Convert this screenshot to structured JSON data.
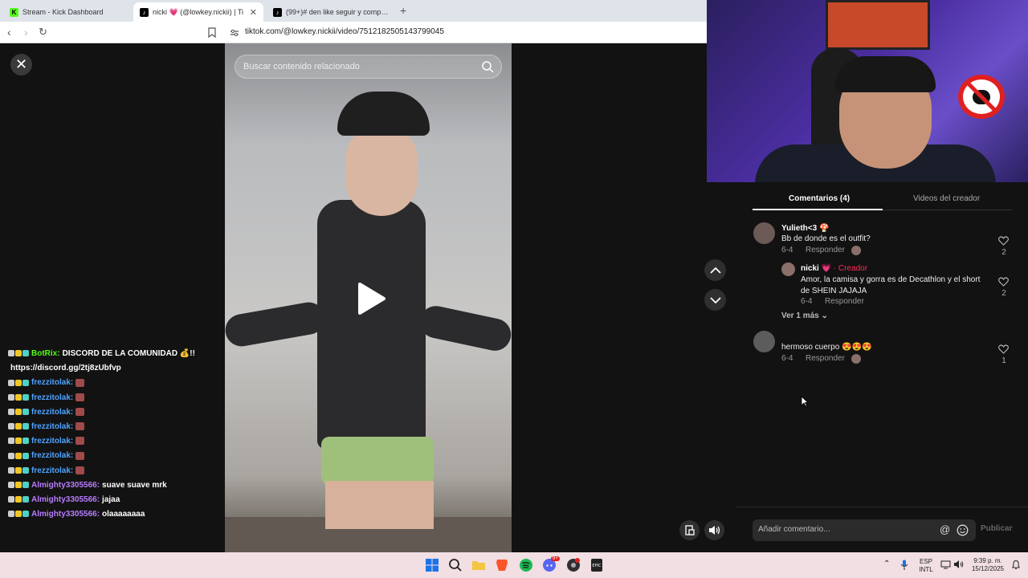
{
  "browser": {
    "tabs": [
      {
        "label": "Stream - Kick Dashboard",
        "favicon_color": "#53fc18",
        "favicon_letter": "K"
      },
      {
        "label": "nicki 💗 (@lowkey.nickii) | Ti",
        "favicon_color": "#000000",
        "favicon_letter": "♪"
      },
      {
        "label": "(99+)# den like seguir y compartir nc",
        "favicon_color": "#000000",
        "favicon_letter": "♪"
      }
    ],
    "url": "tiktok.com/@lowkey.nickii/video/7512182505143799045"
  },
  "video": {
    "search_placeholder": "Buscar contenido relacionado"
  },
  "chat": [
    {
      "user": "BotRix:",
      "message": "DISCORD DE LA COMUNIDAD 💰!!",
      "user_color": "#53fc18"
    },
    {
      "user": "",
      "message": "https://discord.gg/2tj8zUbfvp",
      "user_color": "#ffffff"
    },
    {
      "user": "frezzitolak:",
      "message": "",
      "user_color": "#4fa3ff"
    },
    {
      "user": "frezzitolak:",
      "message": "",
      "user_color": "#4fa3ff"
    },
    {
      "user": "frezzitolak:",
      "message": "",
      "user_color": "#4fa3ff"
    },
    {
      "user": "frezzitolak:",
      "message": "",
      "user_color": "#4fa3ff"
    },
    {
      "user": "frezzitolak:",
      "message": "",
      "user_color": "#4fa3ff"
    },
    {
      "user": "frezzitolak:",
      "message": "",
      "user_color": "#4fa3ff"
    },
    {
      "user": "frezzitolak:",
      "message": "",
      "user_color": "#4fa3ff"
    },
    {
      "user": "Almighty3305566:",
      "message": "suave suave mrk",
      "user_color": "#b77cff"
    },
    {
      "user": "Almighty3305566:",
      "message": "jajaa",
      "user_color": "#b77cff"
    },
    {
      "user": "Almighty3305566:",
      "message": "olaaaaaaaa",
      "user_color": "#b77cff"
    }
  ],
  "comments_panel": {
    "tab_comments": "Comentarios (4)",
    "tab_creator_videos": "Videos del creador",
    "comments": [
      {
        "name": "Yulieth<3 🍄",
        "text": "Bb de donde es el outfit?",
        "date": "6-4",
        "reply": "Responder",
        "likes": "2"
      },
      {
        "name": "nicki 💗",
        "badge": "· Creador",
        "text": "Amor, la camisa y gorra es de Decathlon y el short de SHEIN JAJAJA",
        "date": "6-4",
        "reply": "Responder",
        "likes": "2"
      },
      {
        "name": "",
        "text": "hermoso cuerpo 😍😍😍",
        "date": "6-4",
        "reply": "Responder",
        "likes": "1"
      }
    ],
    "view_more": "Ver 1 más",
    "add_placeholder": "Añadir comentario...",
    "publish": "Publicar"
  },
  "taskbar": {
    "lang": "ESP",
    "layout": "INTL",
    "time": "9:39 p. m.",
    "date": "15/12/2025",
    "discord_badge": "9+"
  }
}
